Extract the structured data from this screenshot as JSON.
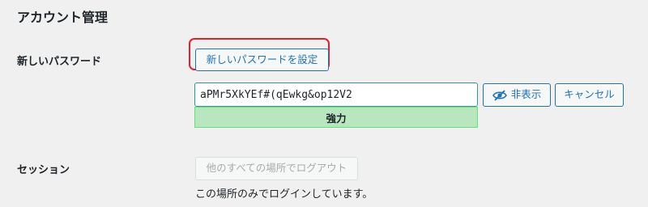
{
  "section": {
    "title": "アカウント管理"
  },
  "password": {
    "label": "新しいパスワード",
    "set_button": "新しいパスワードを設定",
    "value": "aPMr5XkYEf#(qEwkg&op12V2",
    "strength": "強力",
    "hide_button": "非表示",
    "cancel_button": "キャンセル",
    "icon": "eye-slash-icon"
  },
  "session": {
    "label": "セッション",
    "logout_button": "他のすべての場所でログアウト",
    "note": "この場所のみでログインしています。"
  },
  "colors": {
    "accent": "#2271b1",
    "highlight": "#e2202e",
    "strong": "#b8e6bf",
    "strong_border": "#68de7c",
    "input_focus": "#2a9d8f"
  }
}
